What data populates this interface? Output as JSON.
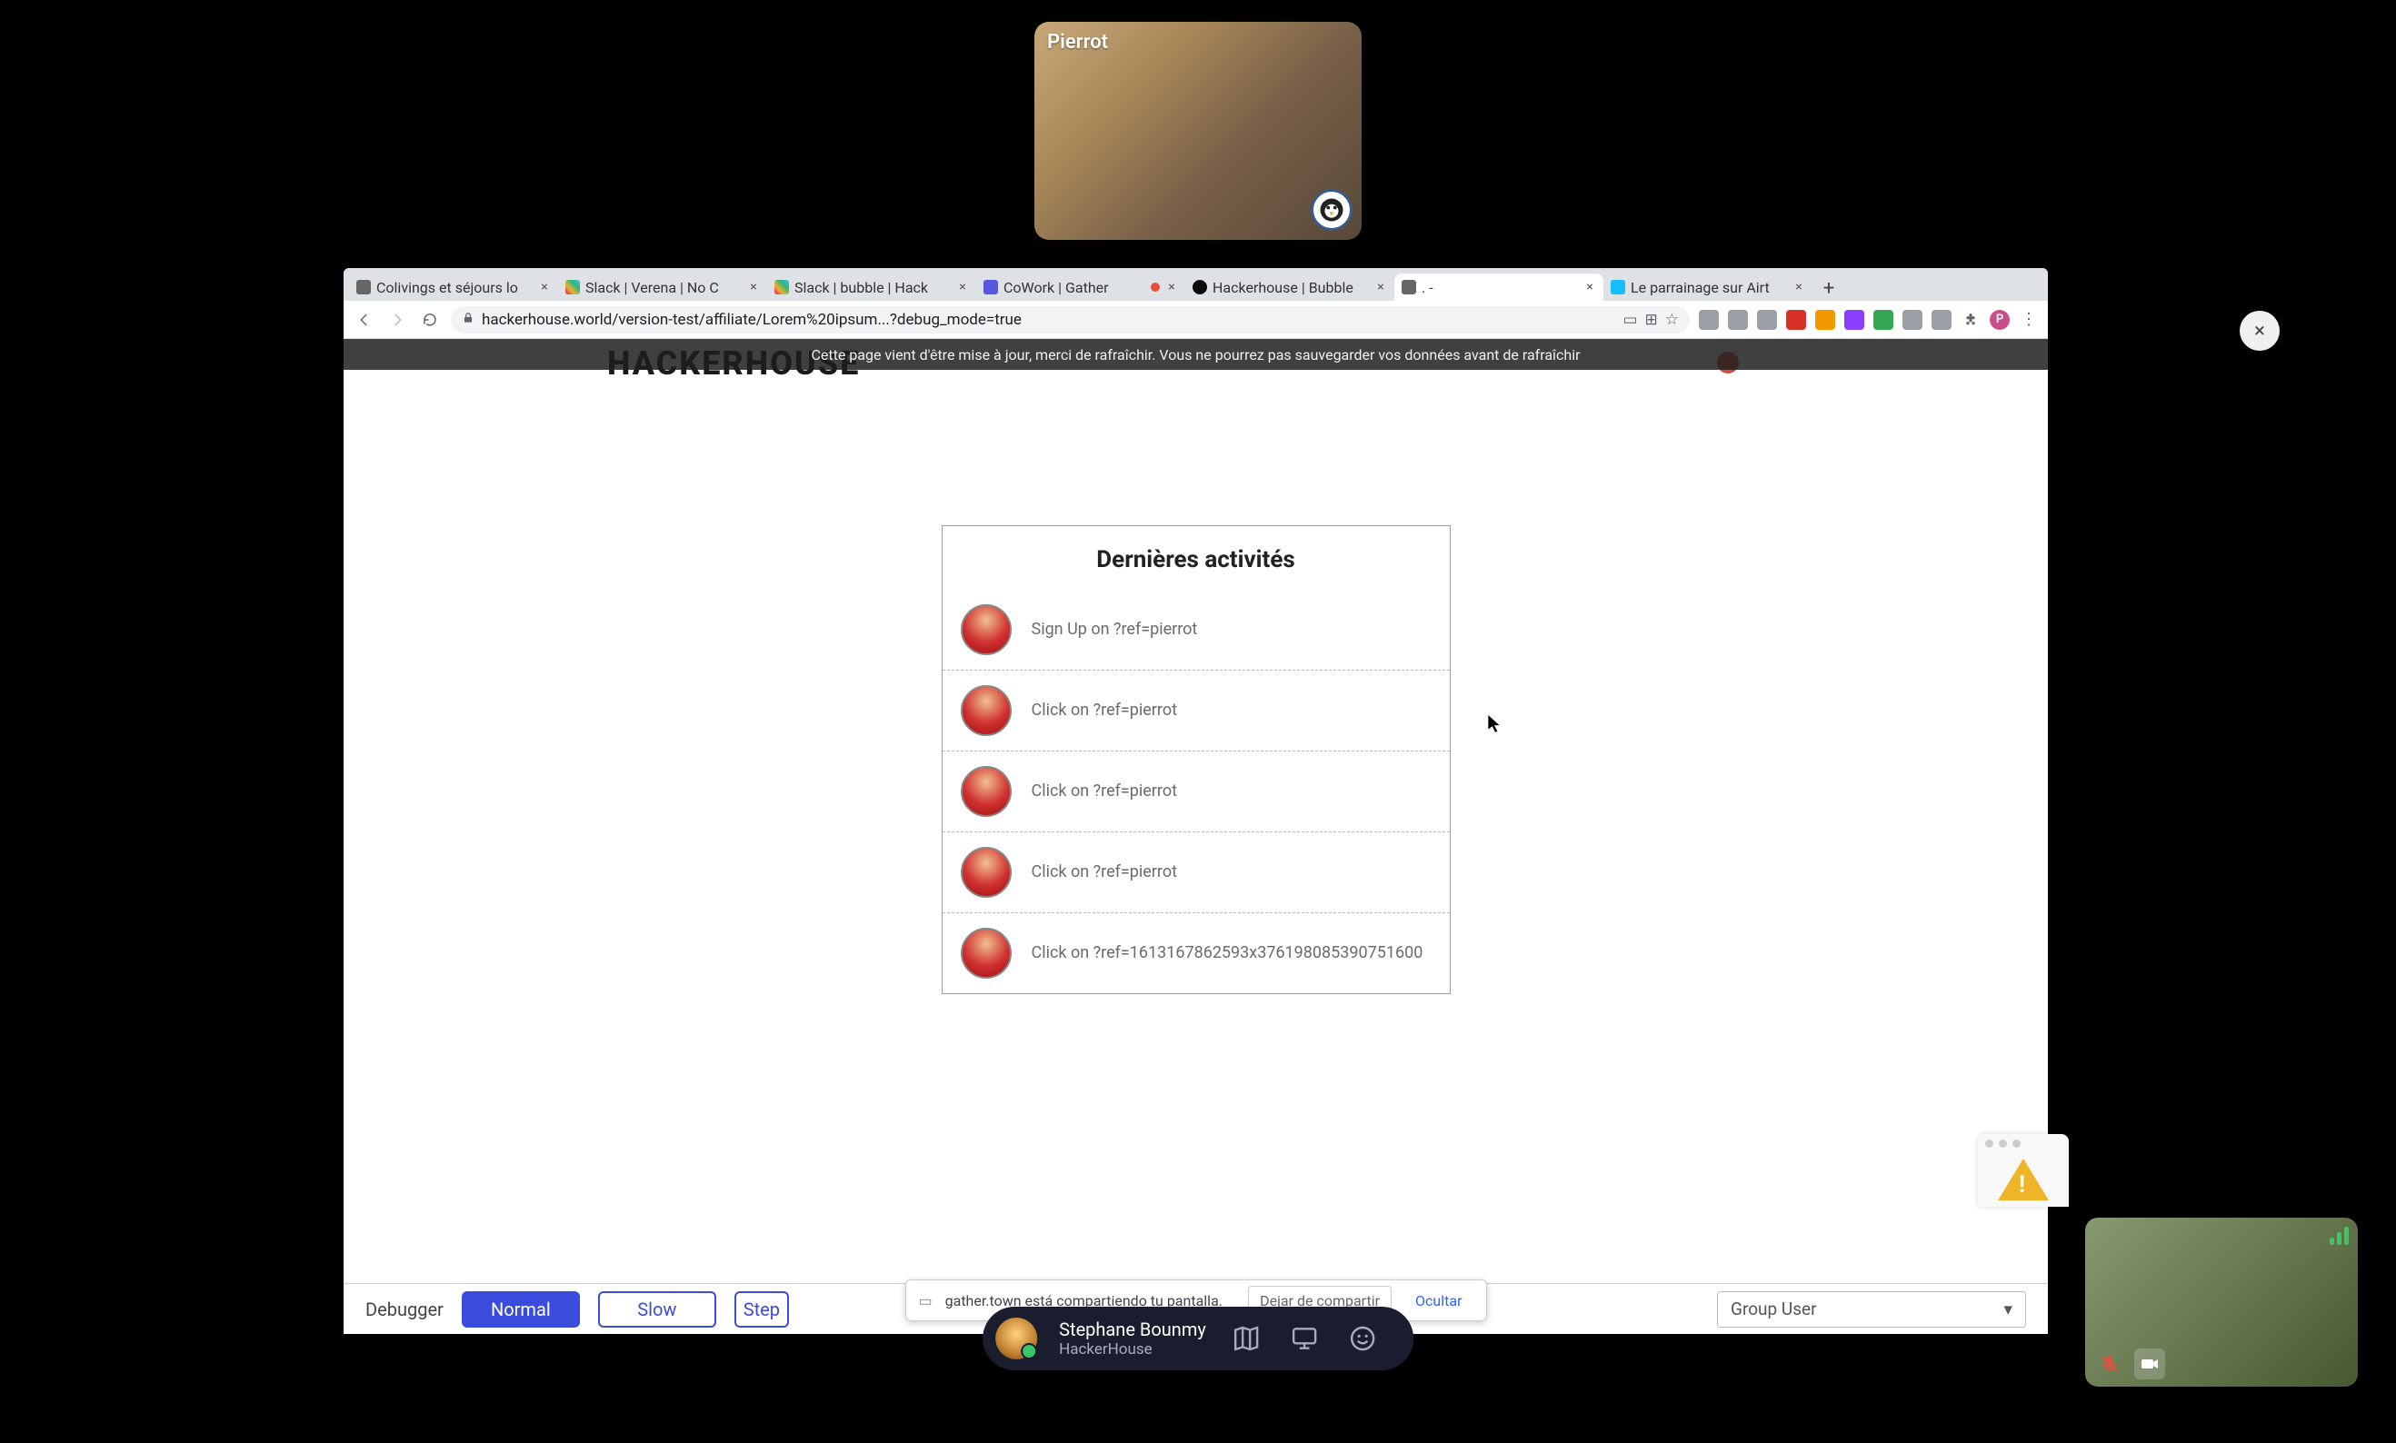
{
  "video_top": {
    "name": "Pierrot"
  },
  "close_button": {
    "glyph": "×"
  },
  "browser": {
    "tabs": [
      {
        "title": "Colivings et séjours lo",
        "favicon": "generic"
      },
      {
        "title": "Slack | Verena | No C",
        "favicon": "slack"
      },
      {
        "title": "Slack | bubble | Hack",
        "favicon": "slack"
      },
      {
        "title": "CoWork | Gather",
        "favicon": "gather",
        "hasStatusDot": true
      },
      {
        "title": "Hackerhouse | Bubble",
        "favicon": "bubble"
      },
      {
        "title": ". -",
        "favicon": "generic",
        "active": true
      },
      {
        "title": "Le parrainage sur Airt",
        "favicon": "airtable"
      }
    ],
    "new_tab_glyph": "+",
    "url": "hackerhouse.world/version-test/affiliate/Lorem%20ipsum...?debug_mode=true",
    "profile_initial": "P"
  },
  "page": {
    "banner": "Cette page vient d'être mise à jour, merci de rafraîchir. Vous ne pourrez pas sauvegarder vos données avant de rafraîchir",
    "brand": "HACKERHOUSE",
    "card_title": "Dernières activités",
    "activities": [
      {
        "text": "Sign Up on ?ref=pierrot"
      },
      {
        "text": "Click on ?ref=pierrot"
      },
      {
        "text": "Click on ?ref=pierrot"
      },
      {
        "text": "Click on ?ref=pierrot"
      },
      {
        "text": "Click on ?ref=1613167862593x376198085390751600"
      }
    ],
    "debugger": {
      "label": "Debugger",
      "normal": "Normal",
      "slow": "Slow",
      "step": "Step",
      "group_user": "Group User"
    },
    "share_notice": {
      "text": "gather.town está compartiendo tu pantalla.",
      "stop": "Dejar de compartir",
      "hide": "Ocultar"
    }
  },
  "dock": {
    "user_name": "Stephane Bounmy",
    "space_name": "HackerHouse"
  }
}
